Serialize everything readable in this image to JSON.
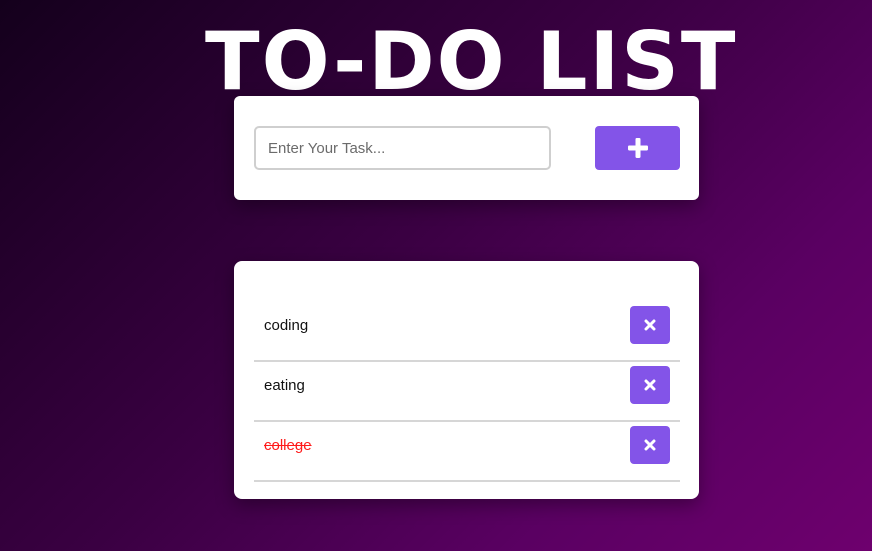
{
  "header": {
    "title": "TO-DO LIST"
  },
  "input_card": {
    "placeholder": "Enter Your Task...",
    "value": "",
    "add_button_icon": "plus-icon"
  },
  "tasks": [
    {
      "text": "coding",
      "completed": false,
      "delete_icon": "close-icon"
    },
    {
      "text": "eating",
      "completed": false,
      "delete_icon": "close-icon"
    },
    {
      "text": "college",
      "completed": true,
      "delete_icon": "close-icon"
    }
  ],
  "colors": {
    "accent": "#8354e8",
    "completed_text": "#ff1a1a",
    "background_start": "#14001c",
    "background_end": "#6e006e"
  }
}
